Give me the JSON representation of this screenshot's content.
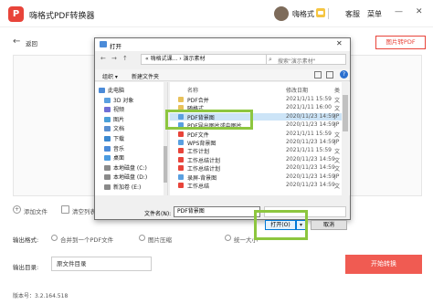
{
  "app": {
    "logo_text": "P",
    "title": "嗨格式PDF转换器"
  },
  "header": {
    "user_name": "嗨格式",
    "service": "客服",
    "menu": "菜单",
    "minimize": "—",
    "close": "✕"
  },
  "nav": {
    "back_label": "返回"
  },
  "top_button": "图片转PDF",
  "actions": {
    "add_file": "添加文件",
    "clear_list": "清空列表"
  },
  "output_format": {
    "label": "输出格式:",
    "options": [
      "合并到一个PDF文件",
      "图片压缩",
      "统一大小"
    ]
  },
  "output_dir": {
    "label": "输出目录:",
    "value": "原文件目录"
  },
  "start_button": "开始转换",
  "version": "版本号：3.2.164.518",
  "dialog": {
    "title": "打开",
    "close": "✕",
    "address": "« 嗨格式课... › 演示素材",
    "search_placeholder": "搜索\"演示素材\"",
    "toolbar": {
      "organize": "组织 ▾",
      "new_folder": "新建文件夹"
    },
    "tree": [
      "此电脑",
      "3D 对象",
      "视频",
      "图片",
      "文档",
      "下载",
      "音乐",
      "桌面",
      "本地磁盘 (C:)",
      "本地磁盘 (D:)",
      "新加卷 (E:)"
    ],
    "columns": {
      "name": "名称",
      "date": "修改日期",
      "type": "类"
    },
    "files": [
      {
        "name": "PDF合并",
        "date": "2021/1/11 15:59",
        "type": "文",
        "kind": "folder"
      },
      {
        "name": "随格式",
        "date": "2021/1/11 16:00",
        "type": "文",
        "kind": "folder"
      },
      {
        "name": "PDF背景图",
        "date": "2020/11/23 14:59",
        "type": "JP",
        "kind": "image",
        "selected": true
      },
      {
        "name": "PDF导出图片或中图片",
        "date": "2020/11/23 14:59",
        "type": "JP",
        "kind": "image"
      },
      {
        "name": "PDF文件",
        "date": "2021/1/11 15:59",
        "type": "文",
        "kind": "pdf"
      },
      {
        "name": "WPS背景图",
        "date": "2020/11/23 14:59",
        "type": "JP",
        "kind": "image"
      },
      {
        "name": "工作计划",
        "date": "2021/1/11 15:59",
        "type": "文",
        "kind": "pdf"
      },
      {
        "name": "工作总结计划",
        "date": "2020/11/23 14:59",
        "type": "文",
        "kind": "pdf"
      },
      {
        "name": "工作总结计划",
        "date": "2020/11/23 14:59",
        "type": "文",
        "kind": "pdf"
      },
      {
        "name": "录屏-背景图",
        "date": "2020/11/23 14:59",
        "type": "JP",
        "kind": "image"
      },
      {
        "name": "工作总结",
        "date": "2020/11/23 14:59",
        "type": "文",
        "kind": "pdf"
      }
    ],
    "filename_label": "文件名(N):",
    "filename_value": "PDF背景图",
    "open_button": "打开(O)",
    "open_arrow": "▾",
    "cancel_button": "取消"
  },
  "colors": {
    "brand": "#e8443a",
    "highlight": "#8dc63f",
    "selected_row": "#cce4f7"
  }
}
